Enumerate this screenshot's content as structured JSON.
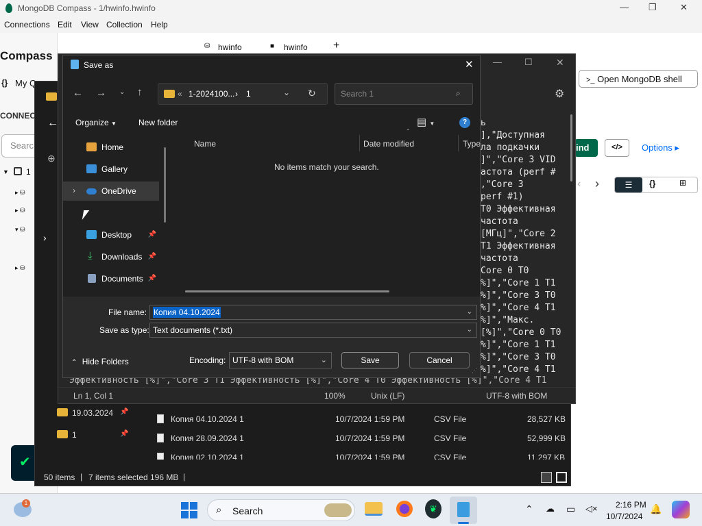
{
  "compass": {
    "title": "MongoDB Compass - 1/hwinfo.hwinfo",
    "menu": [
      "Connections",
      "Edit",
      "View",
      "Collection",
      "Help"
    ],
    "app_label": "Compass",
    "tabs": [
      "hwinfo",
      "hwinfo"
    ],
    "my_queries": "My Q",
    "connections_label": "CONNEC",
    "search_placeholder": "Searc",
    "tree_root": "1",
    "open_shell": "Open MongoDB shell",
    "find_btn": "ind",
    "options": "Options",
    "code_icon": "</>"
  },
  "notepad": {
    "text_lines": [
      "ь",
      "],\"Доступная",
      "ла подкачки",
      "]\",\"Core 3 VID",
      "астота (perf #",
      ",\"Core 3",
      "perf #1)",
      "T0 Эффективная",
      "частота",
      "[МГц]\",\"Core 2",
      "T1 Эффективная",
      "частота",
      "",
      "Core 0 T0",
      "%]\",\"Core 1 T1",
      "%]\",\"Core 3 T0",
      "%]\",\"Core 4 T1",
      "%]\",\"Макс.",
      "[%]\",\"Core 0 T0",
      "%]\",\"Core 1 T1",
      "%]\",\"Core 3 T0",
      "%]\",\"Core 4 T1"
    ],
    "bottom_line": "Эффективность [%]\",\"Core 3 T1 Эффективность [%]\",\"Core 4 T0 Эффективность [%]\",\"Core 4 T1",
    "status": {
      "pos": "Ln 1, Col 1",
      "zoom": "100%",
      "eol": "Unix (LF)",
      "encoding": "UTF-8 with BOM"
    }
  },
  "explorer": {
    "sidebar_extra": [
      {
        "label": "19.03.2024"
      },
      {
        "label": "1"
      }
    ],
    "files": [
      {
        "name": "Копия 04.10.2024 1",
        "date": "10/7/2024 1:59 PM",
        "type": "CSV File",
        "size": "28,527 KB"
      },
      {
        "name": "Копия 28.09.2024 1",
        "date": "10/7/2024 1:59 PM",
        "type": "CSV File",
        "size": "52,999 KB"
      },
      {
        "name": "Копия 02.10.2024 1",
        "date": "10/7/2024 1:59 PM",
        "type": "CSV File",
        "size": "11,297 KB"
      }
    ],
    "status": {
      "items": "50 items",
      "selected": "7 items selected",
      "size": "196 MB"
    }
  },
  "dialog": {
    "title": "Save as",
    "breadcrumb": [
      "1-2024100...",
      "1"
    ],
    "search_placeholder": "Search 1",
    "organize": "Organize",
    "new_folder": "New folder",
    "sidebar": [
      {
        "label": "Home",
        "icon": "home-icon",
        "color": "#e6a23c"
      },
      {
        "label": "Gallery",
        "icon": "gallery-icon",
        "color": "#3a8fd8"
      },
      {
        "label": "OneDrive",
        "icon": "onedrive-icon",
        "color": "#2f7fd0"
      },
      {
        "label": "Desktop",
        "icon": "desktop-icon",
        "color": "#3aa0e0"
      },
      {
        "label": "Downloads",
        "icon": "downloads-icon",
        "color": "#3ec46d"
      },
      {
        "label": "Documents",
        "icon": "documents-icon",
        "color": "#8aa0c0"
      }
    ],
    "columns": [
      "Name",
      "Date modified",
      "Type"
    ],
    "empty_msg": "No items match your search.",
    "file_name_label": "File name:",
    "file_name_value": "Копия 04.10.2024",
    "save_type_label": "Save as type:",
    "save_type_value": "Text documents (*.txt)",
    "hide_folders": "Hide Folders",
    "encoding_label": "Encoding:",
    "encoding_value": "UTF-8 with BOM",
    "save": "Save",
    "cancel": "Cancel"
  },
  "taskbar": {
    "search": "Search",
    "time": "2:16 PM",
    "date": "10/7/2024",
    "notif": "1"
  },
  "colors": {
    "accent": "#0078d4",
    "mongo_green": "#00684a",
    "selection": "#0a64c8"
  }
}
